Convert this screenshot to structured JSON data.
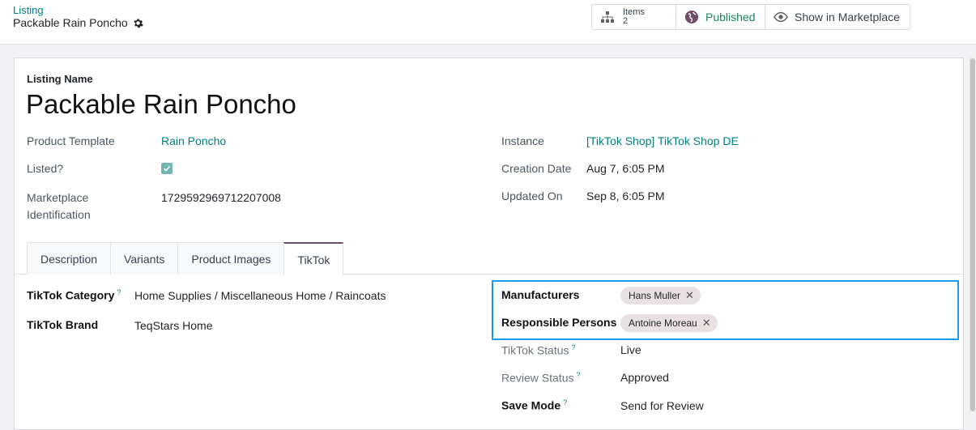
{
  "breadcrumb": {
    "parent": "Listing",
    "current": "Packable Rain Poncho"
  },
  "smart_buttons": {
    "items": {
      "label": "Items",
      "count": "2"
    },
    "published": {
      "label": "Published"
    },
    "show": {
      "label": "Show in Marketplace"
    }
  },
  "form": {
    "listing_name_label": "Listing Name",
    "listing_name": "Packable Rain Poncho",
    "product_template_label": "Product Template",
    "product_template": "Rain Poncho",
    "listed_label": "Listed?",
    "listed": true,
    "marketplace_id_label_1": "Marketplace",
    "marketplace_id_label_2": "Identification",
    "marketplace_id": "1729592969712207008",
    "instance_label": "Instance",
    "instance": "[TikTok Shop] TikTok Shop DE",
    "creation_date_label": "Creation Date",
    "creation_date": "Aug 7, 6:05 PM",
    "updated_on_label": "Updated On",
    "updated_on": "Sep 8, 6:05 PM"
  },
  "tabs": [
    "Description",
    "Variants",
    "Product Images",
    "TikTok"
  ],
  "active_tab": "TikTok",
  "tiktok": {
    "category_label": "TikTok Category",
    "category_help": "?",
    "category": "Home Supplies / Miscellaneous Home / Raincoats",
    "brand_label": "TikTok Brand",
    "brand": "TeqStars Home",
    "manufacturers_label": "Manufacturers",
    "manufacturers": [
      "Hans Muller"
    ],
    "responsible_label": "Responsible Persons",
    "responsible": [
      "Antoine Moreau"
    ],
    "status_label": "TikTok Status",
    "status_help": "?",
    "status": "Live",
    "review_label": "Review Status",
    "review_help": "?",
    "review": "Approved",
    "save_mode_label": "Save Mode",
    "save_mode_help": "?",
    "save_mode": "Send for Review"
  },
  "colors": {
    "accent": "#017e84",
    "tab_active": "#714b67",
    "highlight": "#1a9be8",
    "published": "#198754"
  }
}
